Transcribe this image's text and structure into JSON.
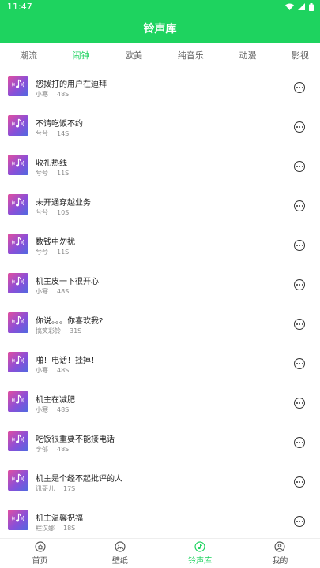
{
  "status_bar": {
    "time": "11:47"
  },
  "app_bar": {
    "title": "铃声库"
  },
  "tabs": [
    {
      "label": "潮流",
      "active": false
    },
    {
      "label": "闹钟",
      "active": true
    },
    {
      "label": "欧美",
      "active": false
    },
    {
      "label": "纯音乐",
      "active": false
    },
    {
      "label": "动漫",
      "active": false
    },
    {
      "label": "影视",
      "active": false
    }
  ],
  "ringtones": [
    {
      "title": "您拨打的用户在迪拜",
      "author": "小寒",
      "duration": "48S"
    },
    {
      "title": "不请吃饭不约",
      "author": "兮兮",
      "duration": "14S"
    },
    {
      "title": "收礼热线",
      "author": "兮兮",
      "duration": "11S"
    },
    {
      "title": "未开通穿越业务",
      "author": "兮兮",
      "duration": "10S"
    },
    {
      "title": "数钱中勿扰",
      "author": "兮兮",
      "duration": "11S"
    },
    {
      "title": "机主皮一下很开心",
      "author": "小寒",
      "duration": "48S"
    },
    {
      "title": "你说。。。你喜欢我?",
      "author": "搞笑彩铃",
      "duration": "31S"
    },
    {
      "title": "啪！电话！挂掉！",
      "author": "小寒",
      "duration": "48S"
    },
    {
      "title": "机主在减肥",
      "author": "小寒",
      "duration": "48S"
    },
    {
      "title": "吃饭很重要不能接电话",
      "author": "李郁",
      "duration": "48S"
    },
    {
      "title": "机主是个经不起批评的人",
      "author": "讯哥儿",
      "duration": "17S"
    },
    {
      "title": "机主温馨祝福",
      "author": "程汉娜",
      "duration": "18S"
    }
  ],
  "bottom_nav": [
    {
      "label": "首页",
      "icon": "home-icon",
      "active": false
    },
    {
      "label": "壁纸",
      "icon": "wallpaper-icon",
      "active": false
    },
    {
      "label": "铃声库",
      "icon": "ringtone-icon",
      "active": true
    },
    {
      "label": "我的",
      "icon": "profile-icon",
      "active": false
    }
  ],
  "colors": {
    "accent": "#1ed35f",
    "thumb_start": "#e14fa0",
    "thumb_end": "#4f6ae0"
  }
}
